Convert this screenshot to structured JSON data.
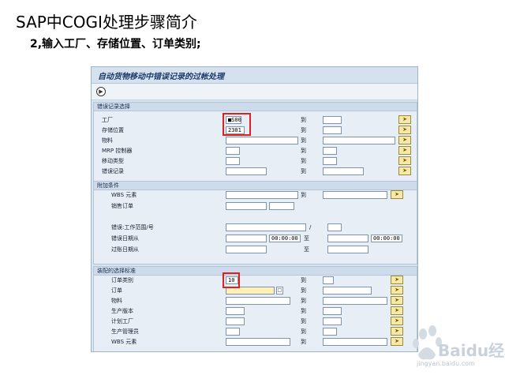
{
  "slide": {
    "title": "SAP中COGI处理步骤简介",
    "subtitle": "2,输入工厂、存储位置、订单类别;"
  },
  "window": {
    "title": "自动货物移动中错误记录的过帐处理"
  },
  "toolbar": {
    "execute_icon": "clock-execute-icon"
  },
  "group1": {
    "title": "错误记录选择",
    "to_label": "到",
    "rows": [
      {
        "label": "工厂",
        "value": "■S00"
      },
      {
        "label": "存储位置",
        "value": "2301"
      },
      {
        "label": "物料",
        "value": ""
      },
      {
        "label": "MRP 控制器",
        "value": ""
      },
      {
        "label": "移动类型",
        "value": ""
      },
      {
        "label": "错误记录",
        "value": ""
      }
    ]
  },
  "group2": {
    "title": "附加条件",
    "to_label": "到",
    "wbs_label": "WBS 元素",
    "sales_order_label": "销售订单",
    "error_work_center_label": "错误:工作范围/号",
    "slash": "/",
    "error_date_label": "错误日期从",
    "posting_date_label": "过账日期从",
    "time_from": "00:00:00",
    "to_short": "至",
    "time_to": "00:00:00"
  },
  "group3": {
    "title": "装配的选择标准",
    "to_label": "到",
    "rows": [
      {
        "label": "订单类别",
        "value": "10"
      },
      {
        "label": "订单",
        "value": ""
      },
      {
        "label": "物料",
        "value": ""
      },
      {
        "label": "生产版本",
        "value": ""
      },
      {
        "label": "计划工厂",
        "value": ""
      },
      {
        "label": "生产管理员",
        "value": ""
      },
      {
        "label": "WBS 元素",
        "value": ""
      }
    ]
  },
  "watermark": {
    "brand": "Baidu经验",
    "url": "jingyan.baidu.com"
  },
  "colors": {
    "window_bg": "#d8e4f0",
    "highlight": "#e02020",
    "required_field": "#fff0b8"
  }
}
